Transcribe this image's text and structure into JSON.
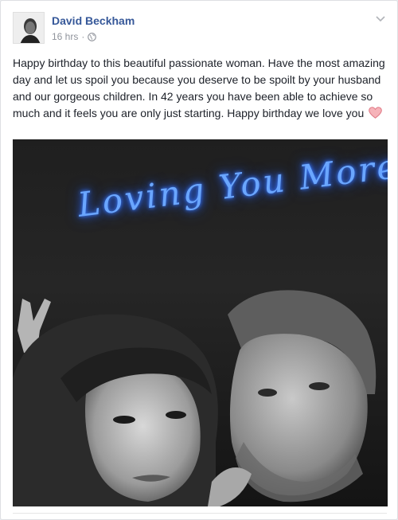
{
  "post": {
    "author_name": "David Beckham",
    "timestamp": "16 hrs",
    "separator": "·",
    "privacy_icon": "globe-icon",
    "options_icon": "chevron-down-icon",
    "text": "Happy birthday to this beautiful passionate woman. Have the most amazing day and let us spoil you because you deserve to be spoilt by your husband and our gorgeous children. In 42 years you have been able to achieve so much and it feels you are only just starting. Happy birthday we love you",
    "emoji_icon": "pink-heart-icon",
    "photo": {
      "neon_text": "Loving You More",
      "description_icon": "couple-selfie-photo"
    }
  },
  "colors": {
    "author_link": "#365899",
    "meta_text": "#90949c",
    "body_text": "#1d2129",
    "neon": "#6aa6ff",
    "heart": "#f4a0a8"
  }
}
